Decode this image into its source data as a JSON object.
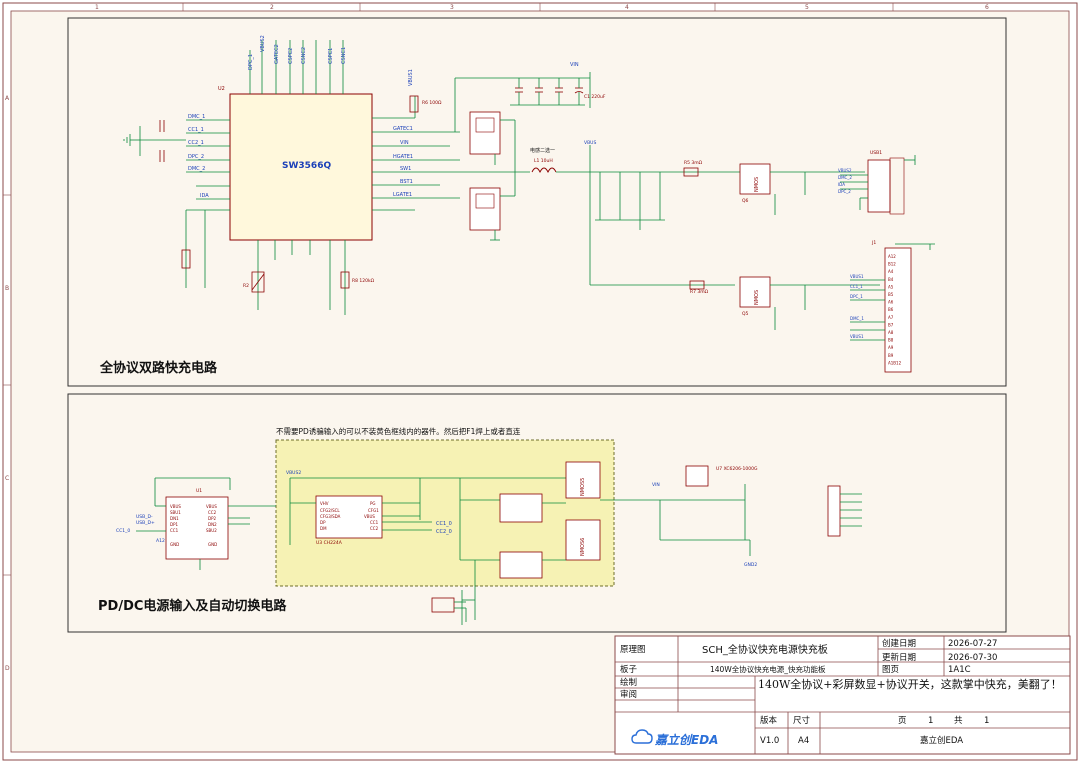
{
  "sheet": {
    "zones_top": [
      "1",
      "2",
      "3",
      "4",
      "5",
      "6"
    ],
    "zones_side": [
      "A",
      "B",
      "C",
      "D"
    ]
  },
  "top_section": {
    "title": "全协议双路快充电路",
    "chip": {
      "ref": "U2",
      "name": "SW3566Q"
    },
    "pin_left": [
      "DMC_1",
      "CC1_1",
      "CC2_1",
      "DPC_2",
      "DMC_2",
      "IDA"
    ],
    "pin_right": [
      "GATEC1",
      "VIN",
      "HGATE1",
      "SW1",
      "BST1",
      "LGATE1"
    ],
    "pin_top": [
      "DPC_1",
      "VBUS2",
      "GATEC2",
      "CSPC2",
      "CSNC2",
      "CSPC1",
      "CSNC1",
      "VBUS1",
      "VIN"
    ],
    "parts": {
      "inductor": "电感二选一",
      "l1": "L1 10uH",
      "cap_c1": "C1 220uF",
      "cap_c2": "C2 220uF",
      "usb_ref": "USB1",
      "typec_ref": "J1",
      "r6": "R6 100Ω",
      "r8": "R8 120kΩ",
      "r2": "R2",
      "vbus": "VBUS",
      "net_r7": "R7 3mΩ",
      "net_r5": "R5 3mΩ",
      "q6": "Q6",
      "q5": "Q5"
    },
    "conn_pins": [
      "A12",
      "B12",
      "A4",
      "B4",
      "A5",
      "B5",
      "A6",
      "B6",
      "A7",
      "B7",
      "A8",
      "B8",
      "A9",
      "B9",
      "A1B12"
    ]
  },
  "bottom_section": {
    "title": "PD/DC电源输入及自动切换电路",
    "note": "不需要PD诱骗输入的可以不装黄色框线内的器件。然后把F1焊上或者直连",
    "u1": "U1",
    "u3": "U3 CH224A",
    "u7": "U7 XC6206-1000G",
    "vbus2": "VBUS2",
    "cc1": "CC1_0",
    "cc2": "CC2_0",
    "mosfets": [
      "NMOS5",
      "NMOS6"
    ],
    "labels_left": [
      "USB_D-",
      "USB_D+",
      "CC1_0",
      "A12"
    ],
    "vin": "VIN",
    "gnd": "GND2"
  },
  "title_block": {
    "r1_label": "原理图",
    "r1_value": "SCH_全协议快充电源快充板",
    "created_label": "创建日期",
    "created_value": "2026-07-27",
    "updated_label": "更新日期",
    "updated_value": "2026-07-30",
    "board_label": "板子",
    "board_value": "140W全协议快充电源_快充功能板",
    "page_label": "图页",
    "page_value": "1A1C",
    "draw_label": "绘制",
    "review_label": "审阅",
    "description": "140W全协议+彩屏数显+协议开关，这款掌中快充，美翻了！",
    "version_label": "版本",
    "size_label": "尺寸",
    "version_value": "V1.0",
    "size_value": "A4",
    "page_word": "页",
    "page_num": "1",
    "total_word": "共",
    "total_num": "1",
    "logo_text": "嘉立创EDA",
    "company": "嘉立创EDA"
  }
}
